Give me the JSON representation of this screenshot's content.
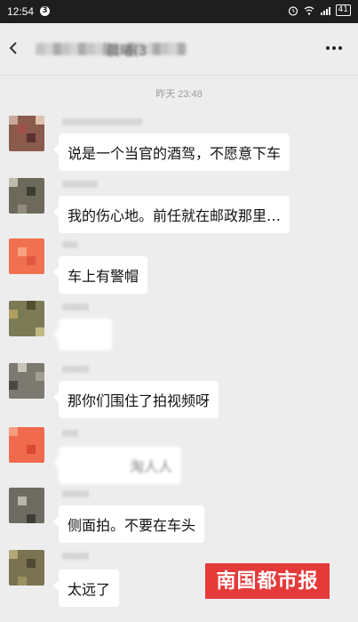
{
  "status_bar": {
    "time": "12:54",
    "notification_count": "3",
    "battery": "41"
  },
  "header": {
    "title_visible_fragment": "晨曦(3"
  },
  "timestamp": "昨天 23:48",
  "messages": [
    {
      "text": "说是一个当官的酒驾，不愿意下车"
    },
    {
      "text": "我的伤心地。前任就在邮政那里…"
    },
    {
      "text": "车上有警帽"
    },
    {
      "text": ""
    },
    {
      "text": "那你们围住了拍视频呀"
    },
    {
      "text": "淘人人"
    },
    {
      "text": "侧面拍。不要在车头"
    },
    {
      "text": "太远了"
    }
  ],
  "watermark": {
    "logo_text": "南国都市报"
  },
  "colors": {
    "background": "#ededed",
    "bubble": "#ffffff",
    "logo": "#e43b3a",
    "status_bar": "#1e1e1e"
  }
}
